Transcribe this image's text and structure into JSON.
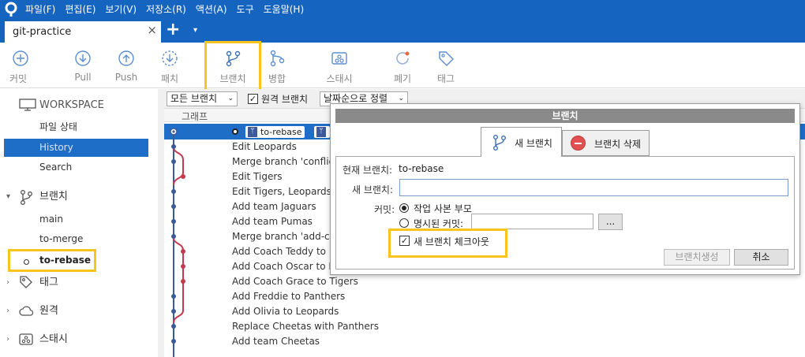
{
  "menu": [
    "파일(F)",
    "편집(E)",
    "보기(V)",
    "저장소(R)",
    "액션(A)",
    "도구",
    "도움말(H)"
  ],
  "tab": {
    "title": "git-practice",
    "close": "×",
    "add": "+",
    "dropdown": "▾"
  },
  "toolbar": {
    "commit": "커밋",
    "pull": "Pull",
    "push": "Push",
    "patch": "패치",
    "branch": "브랜치",
    "merge": "병합",
    "stash": "스태시",
    "discard": "폐기",
    "tag": "태그"
  },
  "sidebar": {
    "workspace": "WORKSPACE",
    "file_status": "파일 상태",
    "history": "History",
    "search": "Search",
    "branches_header": "브랜치",
    "branches": [
      "main",
      "to-merge",
      "to-rebase"
    ],
    "tags_header": "태그",
    "remotes_header": "원격",
    "stash_header": "스태시"
  },
  "history": {
    "filter_all_branches": "모든 브랜치",
    "filter_remote": "원격 브랜치",
    "sort_label": "날짜순으로 정렬",
    "column_graph": "그래프",
    "current_tag": "to-rebase",
    "commits": [
      "Edit Leopards",
      "Merge branch 'conflict",
      "Edit Tigers",
      "Edit Tigers, Leopards, P",
      "Add team Jaguars",
      "Add team Pumas",
      "Merge branch 'add-coa",
      "Add Coach Teddy to P",
      "Add Coach Oscar to Le",
      "Add Coach Grace to Tigers",
      "Add Freddie to Panthers",
      "Add Olivia to Leopards",
      "Replace Cheetas with Panthers",
      "Add team Cheetas"
    ]
  },
  "dialog": {
    "title": "브랜치",
    "tab_new": "새 브랜치",
    "tab_delete": "브랜치 삭제",
    "current_branch_label": "현재 브랜치:",
    "current_branch_value": "to-rebase",
    "new_branch_label": "새 브랜치:",
    "new_branch_value": "",
    "commit_label": "커밋:",
    "option_working_parent": "작업 사본 부모",
    "option_specified": "명시된 커밋:",
    "browse": "...",
    "checkout_label": "새 브랜치 체크아웃",
    "create_button": "브랜치생성",
    "cancel_button": "취소"
  },
  "colors": {
    "accent": "#1565c0",
    "selection": "#1e6ec8",
    "highlight": "#f7c51e",
    "graph_blue": "#3c5a99",
    "graph_red": "#c23b4e",
    "delete_red": "#e15050"
  }
}
